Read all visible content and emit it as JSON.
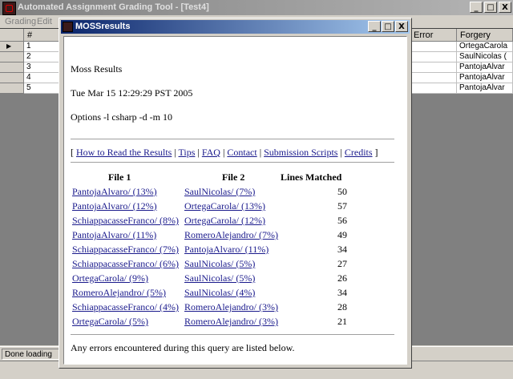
{
  "app": {
    "title": "Automated Assignment Grading Tool - [Test4]",
    "menu": [
      "Grading",
      "Edit"
    ],
    "buttons": {
      "minimize": "_",
      "maximize": "□",
      "close": "X"
    }
  },
  "grid": {
    "columns": {
      "num": "#",
      "error": "Error",
      "forgery": "Forgery"
    },
    "rows": [
      {
        "num": "1",
        "forgery": "OrtegaCarola"
      },
      {
        "num": "2",
        "forgery": "SaulNicolas ("
      },
      {
        "num": "3",
        "forgery": "PantojaAlvar"
      },
      {
        "num": "4",
        "forgery": "PantojaAlvar"
      },
      {
        "num": "5",
        "forgery": "PantojaAlvar"
      }
    ],
    "current_row_marker": "▶"
  },
  "status": {
    "text": "Done loading"
  },
  "moss": {
    "title": "MOSSresults",
    "heading": "Moss Results",
    "date": "Tue Mar 15 12:29:29 PST 2005",
    "options": "Options -l csharp -d -m 10",
    "links": [
      "How to Read the Results",
      "Tips",
      "FAQ",
      "Contact",
      "Submission Scripts",
      "Credits"
    ],
    "table": {
      "headers": {
        "file1": "File 1",
        "file2": "File 2",
        "lines": "Lines Matched"
      },
      "rows": [
        {
          "file1": "PantojaAlvaro/ (13%)",
          "file2": "SaulNicolas/ (7%)",
          "lines": "50"
        },
        {
          "file1": "PantojaAlvaro/ (12%)",
          "file2": "OrtegaCarola/ (13%)",
          "lines": "57"
        },
        {
          "file1": "SchiappacasseFranco/ (8%)",
          "file2": "OrtegaCarola/ (12%)",
          "lines": "56"
        },
        {
          "file1": "PantojaAlvaro/ (11%)",
          "file2": "RomeroAlejandro/ (7%)",
          "lines": "49"
        },
        {
          "file1": "SchiappacasseFranco/ (7%)",
          "file2": "PantojaAlvaro/ (11%)",
          "lines": "34"
        },
        {
          "file1": "SchiappacasseFranco/ (6%)",
          "file2": "SaulNicolas/ (5%)",
          "lines": "27"
        },
        {
          "file1": "OrtegaCarola/ (9%)",
          "file2": "SaulNicolas/ (5%)",
          "lines": "26"
        },
        {
          "file1": "RomeroAlejandro/ (5%)",
          "file2": "SaulNicolas/ (4%)",
          "lines": "34"
        },
        {
          "file1": "SchiappacasseFranco/ (4%)",
          "file2": "RomeroAlejandro/ (3%)",
          "lines": "28"
        },
        {
          "file1": "OrtegaCarola/ (5%)",
          "file2": "RomeroAlejandro/ (3%)",
          "lines": "21"
        }
      ]
    },
    "footer": "Any errors encountered during this query are listed below."
  }
}
